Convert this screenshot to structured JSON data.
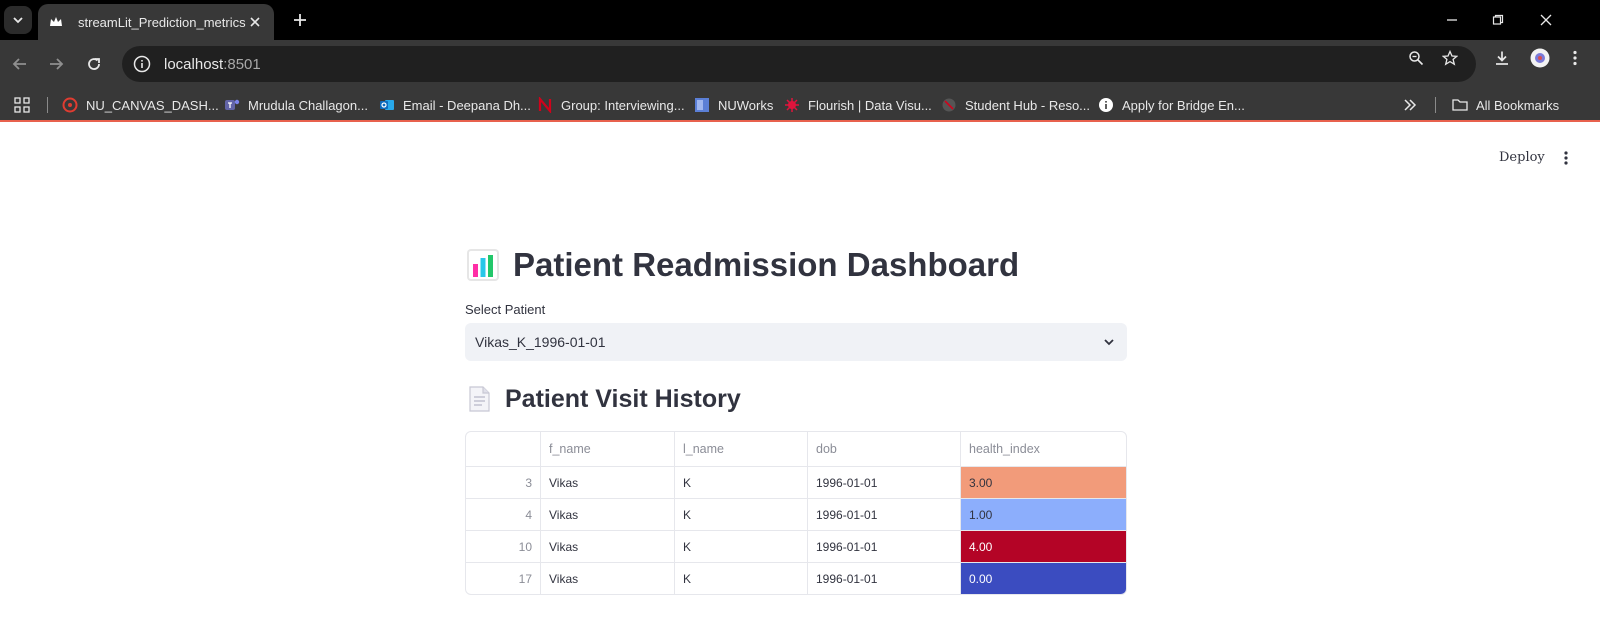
{
  "browser": {
    "tab_title": "streamLit_Prediction_metrics",
    "url_host": "localhost",
    "url_port": ":8501",
    "bookmarks": [
      {
        "label": "NU_CANVAS_DASH...",
        "icon": "canvas-icon",
        "color": "#e03c31"
      },
      {
        "label": "Mrudula Challagon...",
        "icon": "teams-icon",
        "color": "#6264a7"
      },
      {
        "label": "Email - Deepana Dh...",
        "icon": "outlook-icon",
        "color": "#0f6cbd"
      },
      {
        "label": "Group: Interviewing...",
        "icon": "n-logo-icon",
        "color": "#d0021b"
      },
      {
        "label": "NUWorks",
        "icon": "nuworks-icon",
        "color": "#5b7fd6"
      },
      {
        "label": "Flourish | Data Visu...",
        "icon": "flourish-icon",
        "color": "#e0143c"
      },
      {
        "label": "Student Hub - Reso...",
        "icon": "studenthub-icon",
        "color": "#6b6b6b"
      },
      {
        "label": "Apply for Bridge En...",
        "icon": "info-circle-icon",
        "color": "#ffffff"
      }
    ],
    "all_bookmarks_label": "All Bookmarks"
  },
  "app": {
    "deploy_label": "Deploy",
    "title": "Patient Readmission Dashboard",
    "select_label": "Select Patient",
    "select_value": "Vikas_K_1996-01-01",
    "section_title": "Patient Visit History"
  },
  "table": {
    "columns": [
      "",
      "f_name",
      "l_name",
      "dob",
      "health_index"
    ],
    "rows": [
      {
        "index": "3",
        "f_name": "Vikas",
        "l_name": "K",
        "dob": "1996-01-01",
        "health_index": "3.00",
        "bg": "#f29b7a",
        "fg": "#31333f"
      },
      {
        "index": "4",
        "f_name": "Vikas",
        "l_name": "K",
        "dob": "1996-01-01",
        "health_index": "1.00",
        "bg": "#8caefc",
        "fg": "#31333f"
      },
      {
        "index": "10",
        "f_name": "Vikas",
        "l_name": "K",
        "dob": "1996-01-01",
        "health_index": "4.00",
        "bg": "#b40426",
        "fg": "#ffffff"
      },
      {
        "index": "17",
        "f_name": "Vikas",
        "l_name": "K",
        "dob": "1996-01-01",
        "health_index": "0.00",
        "bg": "#3b4cc0",
        "fg": "#ffffff"
      }
    ]
  }
}
